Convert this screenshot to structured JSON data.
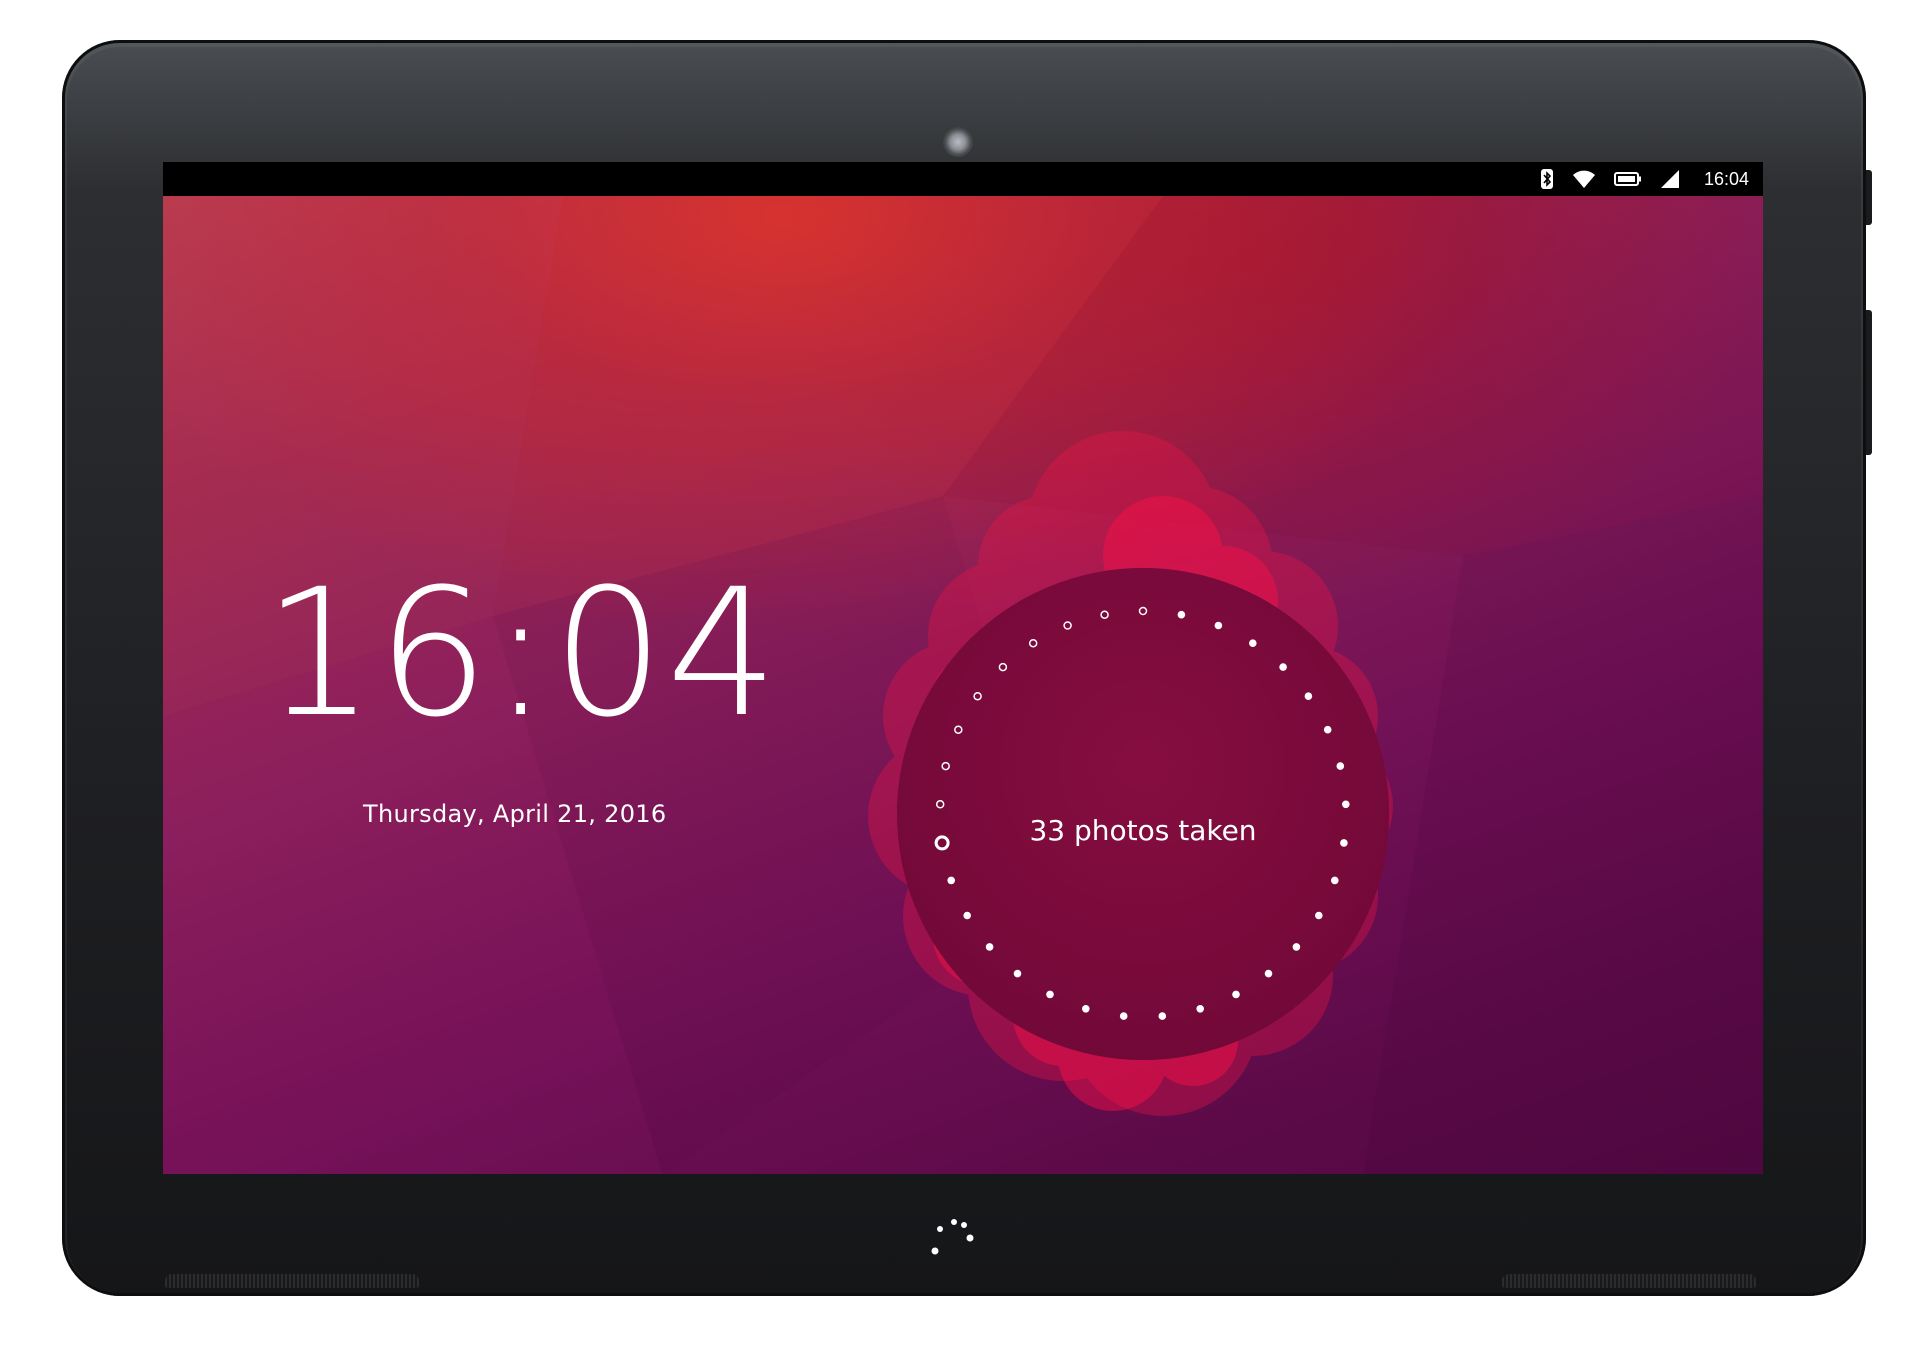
{
  "status_bar": {
    "time": "16:04",
    "icons": [
      "bluetooth-icon",
      "wifi-icon",
      "battery-icon",
      "signal-icon"
    ]
  },
  "lock_screen": {
    "time": "16:04",
    "date": "Thursday, April 21, 2016",
    "infographic": {
      "label": "33 photos taken",
      "total_dots": 33,
      "highlighted_dot_index": 24
    }
  },
  "colors": {
    "bezel": "#1e1f22",
    "wallpaper_top": "#c8313f",
    "wallpaper_bottom": "#520843",
    "infographic_circle": "#7a0a3c",
    "bubble": "#e8123c"
  },
  "hardware": {
    "home_button_icon": "ubuntu-dots-icon",
    "camera_icon": "front-camera-icon"
  }
}
